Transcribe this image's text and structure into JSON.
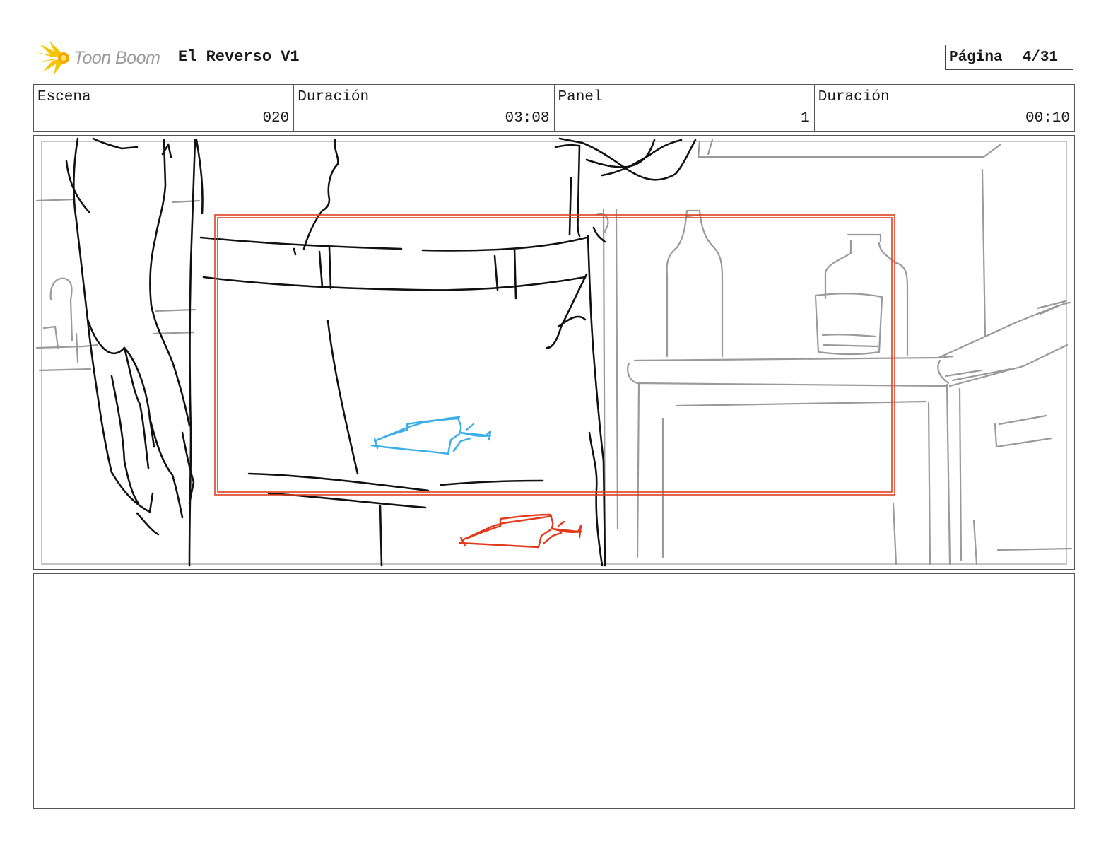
{
  "header": {
    "logo_text": "Toon Boom",
    "project_title": "El Reverso V1",
    "page_label": "Página",
    "page_number": "4/31"
  },
  "info": {
    "scene_label": "Escena",
    "scene_value": "020",
    "scene_duration_label": "Duración",
    "scene_duration_value": "03:08",
    "panel_label": "Panel",
    "panel_value": "1",
    "panel_duration_label": "Duración",
    "panel_duration_value": "00:10"
  },
  "panel": {
    "notes": ""
  },
  "colors": {
    "sketch_ink": "#111111",
    "background_ink": "#9a9a9a",
    "camera_frame": "#e04020",
    "arrow_blue": "#3aaee8",
    "arrow_red": "#e03a1a",
    "logo_yellow": "#f5c400"
  },
  "icons": {
    "logo": "toon-boom-burst-icon",
    "arrow_blue": "camera-move-arrow-icon",
    "arrow_red": "camera-move-arrow-icon"
  }
}
